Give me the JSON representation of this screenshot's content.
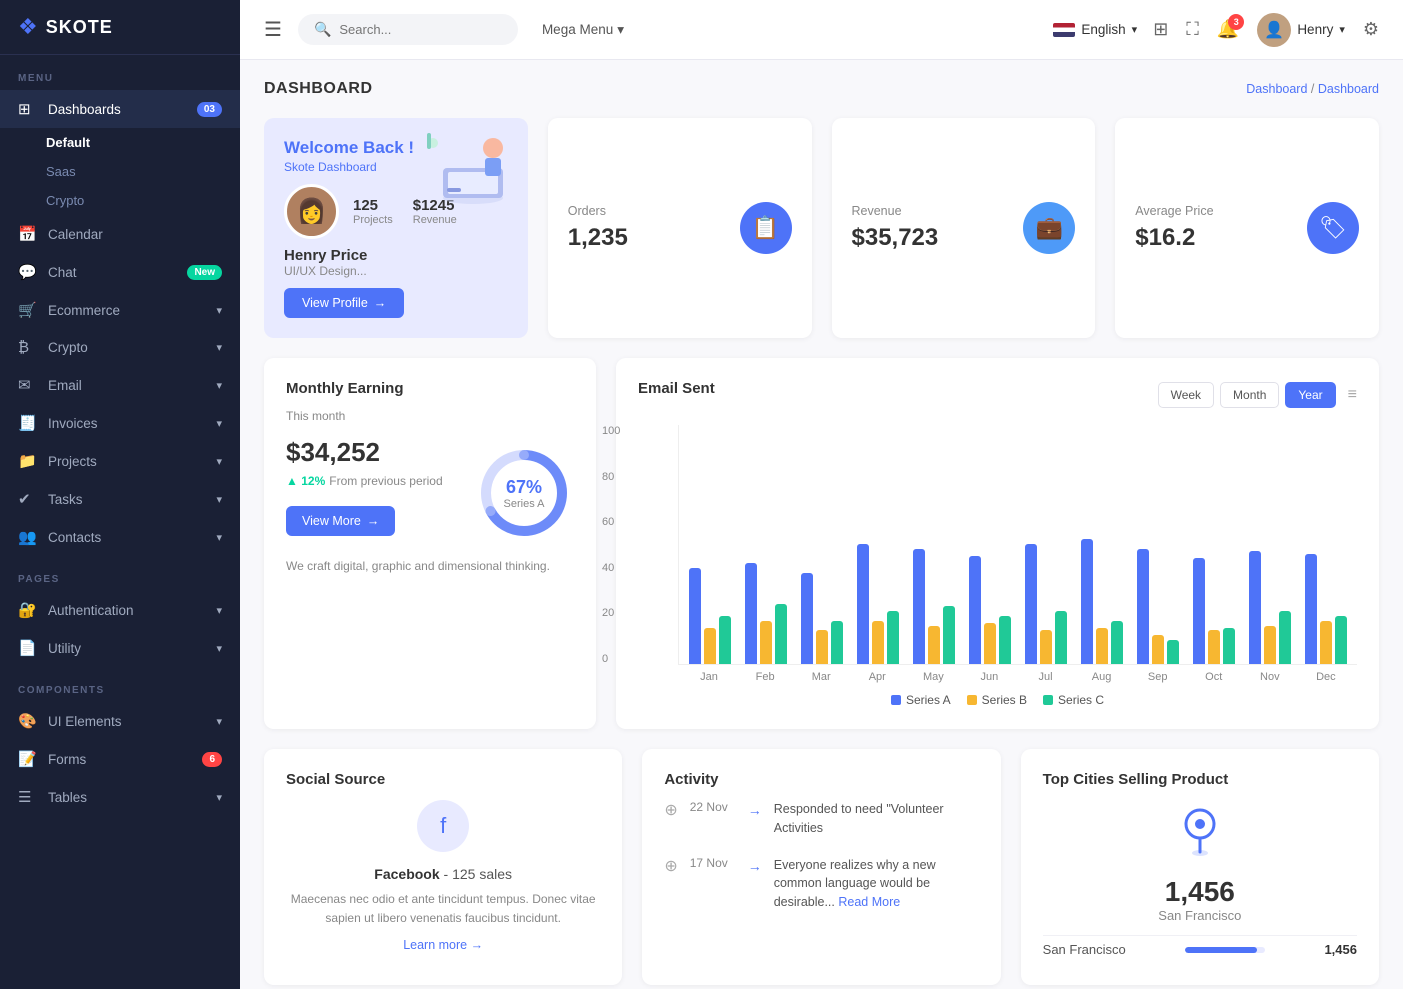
{
  "sidebar": {
    "logo": "SKOTE",
    "sections": [
      {
        "label": "MENU",
        "items": [
          {
            "id": "dashboards",
            "icon": "⊞",
            "label": "Dashboards",
            "badge": "03",
            "active": true,
            "sub": [
              "Default",
              "Saas",
              "Crypto"
            ]
          },
          {
            "id": "calendar",
            "icon": "📅",
            "label": "Calendar"
          },
          {
            "id": "chat",
            "icon": "💬",
            "label": "Chat",
            "badge_green": "New"
          },
          {
            "id": "ecommerce",
            "icon": "🛒",
            "label": "Ecommerce",
            "has_chevron": true
          },
          {
            "id": "crypto",
            "icon": "₿",
            "label": "Crypto",
            "has_chevron": true
          },
          {
            "id": "email",
            "icon": "✉",
            "label": "Email",
            "has_chevron": true
          },
          {
            "id": "invoices",
            "icon": "🧾",
            "label": "Invoices",
            "has_chevron": true
          },
          {
            "id": "projects",
            "icon": "📁",
            "label": "Projects",
            "has_chevron": true
          },
          {
            "id": "tasks",
            "icon": "✔",
            "label": "Tasks",
            "has_chevron": true
          },
          {
            "id": "contacts",
            "icon": "👥",
            "label": "Contacts",
            "has_chevron": true
          }
        ]
      },
      {
        "label": "PAGES",
        "items": [
          {
            "id": "authentication",
            "icon": "🔐",
            "label": "Authentication",
            "has_chevron": true
          },
          {
            "id": "utility",
            "icon": "📄",
            "label": "Utility",
            "has_chevron": true
          }
        ]
      },
      {
        "label": "COMPONENTS",
        "items": [
          {
            "id": "ui-elements",
            "icon": "🎨",
            "label": "UI Elements",
            "has_chevron": true
          },
          {
            "id": "forms",
            "icon": "📝",
            "label": "Forms",
            "badge_red": "6",
            "has_chevron": true
          },
          {
            "id": "tables",
            "icon": "☰",
            "label": "Tables",
            "has_chevron": true
          }
        ]
      }
    ]
  },
  "header": {
    "search_placeholder": "Search...",
    "mega_menu": "Mega Menu",
    "language": "English",
    "notifications_count": "3",
    "user_name": "Henry"
  },
  "breadcrumb": {
    "root": "Dashboard",
    "current": "Dashboard"
  },
  "page_title": "DASHBOARD",
  "welcome": {
    "title": "Welcome Back !",
    "subtitle": "Skote Dashboard",
    "name": "Henry Price",
    "role": "UI/UX Design...",
    "projects_count": "125",
    "projects_label": "Projects",
    "revenue_amount": "$1245",
    "revenue_label": "Revenue",
    "view_profile": "View Profile"
  },
  "stats": [
    {
      "label": "Orders",
      "value": "1,235",
      "icon": "📋",
      "color": "blue"
    },
    {
      "label": "Revenue",
      "value": "$35,723",
      "icon": "💼",
      "color": "teal"
    },
    {
      "label": "Average Price",
      "value": "$16.2",
      "icon": "🏷",
      "color": "purple"
    }
  ],
  "monthly_earning": {
    "title": "Monthly Earning",
    "period": "This month",
    "amount": "$34,252",
    "change_pct": "12%",
    "change_label": "From previous period",
    "donut_pct": "67%",
    "donut_series": "Series A",
    "view_more": "View More",
    "description": "We craft digital, graphic and dimensional thinking."
  },
  "email_sent": {
    "title": "Email Sent",
    "periods": [
      "Week",
      "Month",
      "Year"
    ],
    "active_period": "Year",
    "y_labels": [
      "100",
      "80",
      "60",
      "40",
      "20",
      "0"
    ],
    "x_labels": [
      "Jan",
      "Feb",
      "Mar",
      "Apr",
      "May",
      "Jun",
      "Jul",
      "Aug",
      "Sep",
      "Oct",
      "Nov",
      "Dec"
    ],
    "series": {
      "A": [
        40,
        42,
        38,
        50,
        48,
        45,
        50,
        52,
        48,
        44,
        47,
        46
      ],
      "B": [
        15,
        18,
        14,
        18,
        16,
        17,
        14,
        15,
        12,
        14,
        16,
        18
      ],
      "C": [
        20,
        25,
        18,
        22,
        24,
        20,
        22,
        18,
        10,
        15,
        22,
        20
      ]
    },
    "legend": [
      "Series A",
      "Series B",
      "Series C"
    ]
  },
  "social_source": {
    "title": "Social Source",
    "platform": "Facebook",
    "sales": "125 sales",
    "description": "Maecenas nec odio et ante tincidunt tempus. Donec vitae sapien ut libero venenatis faucibus tincidunt.",
    "learn_more": "Learn more"
  },
  "activity": {
    "title": "Activity",
    "items": [
      {
        "date": "22 Nov",
        "text": "Responded to need \"Volunteer Activities"
      },
      {
        "date": "17 Nov",
        "text": "Everyone realizes why a new common language would be desirable...",
        "read_more": "Read More"
      }
    ]
  },
  "top_cities": {
    "title": "Top Cities Selling Product",
    "top_count": "1,456",
    "top_city": "San Francisco",
    "rows": [
      {
        "city": "San Francisco",
        "value": "1,456",
        "pct": 90
      }
    ]
  }
}
